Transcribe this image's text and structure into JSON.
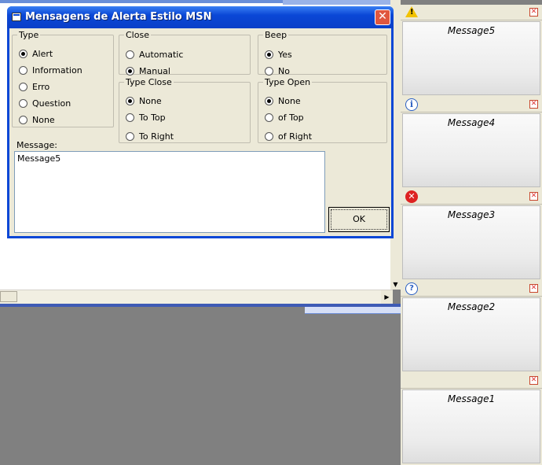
{
  "dialog": {
    "title": "Mensagens de Alerta Estilo MSN",
    "close_glyph": "✕"
  },
  "type_group": {
    "legend": "Type",
    "options": [
      "Alert",
      "Information",
      "Erro",
      "Question",
      "None"
    ],
    "selected": "Alert"
  },
  "close_group": {
    "legend": "Close",
    "options": [
      "Automatic",
      "Manual"
    ],
    "selected": "Manual"
  },
  "beep_group": {
    "legend": "Beep",
    "options": [
      "Yes",
      "No"
    ],
    "selected": "Yes"
  },
  "type_close_group": {
    "legend": "Type Close",
    "options": [
      "None",
      "To Top",
      "To Right"
    ],
    "selected": "None"
  },
  "type_open_group": {
    "legend": "Type Open",
    "options": [
      "None",
      "of Top",
      "of Right"
    ],
    "selected": "None"
  },
  "message": {
    "label": "Message:",
    "value": "Message5"
  },
  "ok_button": {
    "label": "OK"
  },
  "notifications": [
    {
      "icon": "warning-icon",
      "text": "Message5"
    },
    {
      "icon": "info-icon",
      "text": "Message4"
    },
    {
      "icon": "error-icon",
      "text": "Message3"
    },
    {
      "icon": "question-icon",
      "text": "Message2"
    },
    {
      "icon": "none",
      "text": "Message1"
    }
  ]
}
